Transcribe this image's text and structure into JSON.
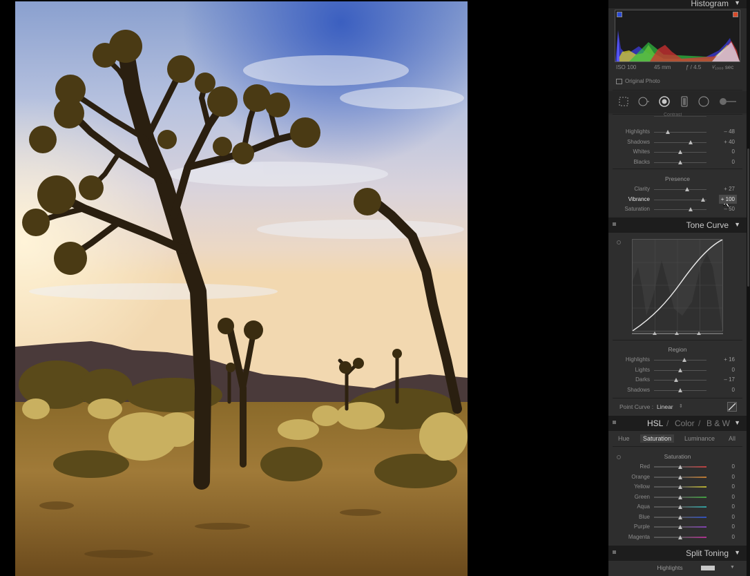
{
  "histogram": {
    "title": "Histogram",
    "iso": "ISO 100",
    "focal": "45 mm",
    "aperture": "ƒ / 4.5",
    "shutter": "¹⁄₁₀₀₀ sec",
    "original_photo_label": "Original Photo"
  },
  "tools": [
    "crop-overlay-icon",
    "spot-removal-icon",
    "red-eye-icon",
    "graduated-filter-icon",
    "radial-filter-icon",
    "adjustment-brush-icon"
  ],
  "basic": {
    "partial_label": "Contrast",
    "tone_rows": [
      {
        "label": "Highlights",
        "value": "– 48",
        "pos": 0.26
      },
      {
        "label": "Shadows",
        "value": "+ 40",
        "pos": 0.7
      },
      {
        "label": "Whites",
        "value": "0",
        "pos": 0.5
      },
      {
        "label": "Blacks",
        "value": "0",
        "pos": 0.5
      }
    ],
    "presence_label": "Presence",
    "presence_rows": [
      {
        "label": "Clarity",
        "value": "+ 27",
        "pos": 0.63
      },
      {
        "label": "Vibrance",
        "value": "+ 100",
        "pos": 0.93,
        "active": true
      },
      {
        "label": "Saturation",
        "value": "– 50",
        "pos": 0.7
      }
    ]
  },
  "tone_curve": {
    "title": "Tone Curve",
    "region_label": "Region",
    "rows": [
      {
        "label": "Highlights",
        "value": "+ 16",
        "pos": 0.58
      },
      {
        "label": "Lights",
        "value": "0",
        "pos": 0.5
      },
      {
        "label": "Darks",
        "value": "– 17",
        "pos": 0.42
      },
      {
        "label": "Shadows",
        "value": "0",
        "pos": 0.5
      }
    ],
    "point_curve_label": "Point Curve :",
    "point_curve_value": "Linear"
  },
  "hsl": {
    "title_hsl": "HSL",
    "title_color": "Color",
    "title_bw": "B & W",
    "slash": "/",
    "tabs": [
      "Hue",
      "Saturation",
      "Luminance",
      "All"
    ],
    "selected_tab": 1,
    "section_label": "Saturation",
    "rows": [
      {
        "label": "Red",
        "value": "0",
        "color": "#c04040"
      },
      {
        "label": "Orange",
        "value": "0",
        "color": "#c07a30"
      },
      {
        "label": "Yellow",
        "value": "0",
        "color": "#b8b030"
      },
      {
        "label": "Green",
        "value": "0",
        "color": "#40a040"
      },
      {
        "label": "Aqua",
        "value": "0",
        "color": "#30a0a0"
      },
      {
        "label": "Blue",
        "value": "0",
        "color": "#3050c0"
      },
      {
        "label": "Purple",
        "value": "0",
        "color": "#8040b0"
      },
      {
        "label": "Magenta",
        "value": "0",
        "color": "#b03090"
      }
    ]
  },
  "split_toning": {
    "title": "Split Toning",
    "highlights_label": "Highlights"
  }
}
